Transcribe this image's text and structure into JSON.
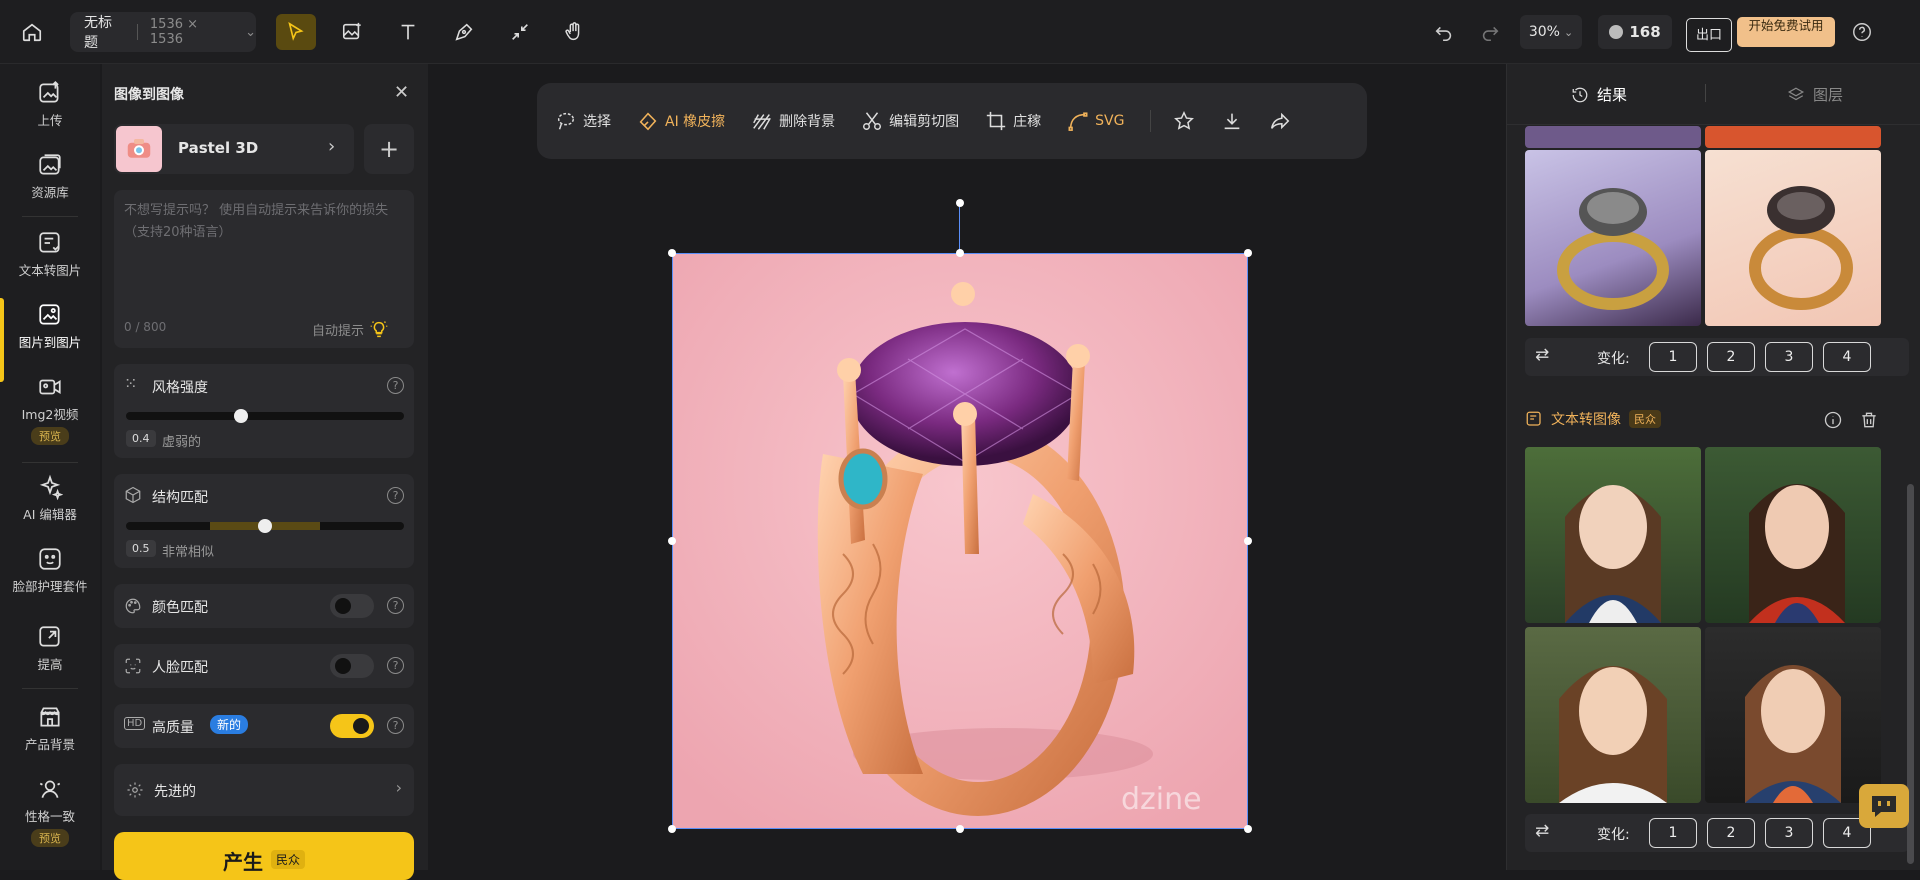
{
  "topbar": {
    "title": "无标题",
    "dimensions": "1536 × 1536",
    "zoom": "30%",
    "credits": "168",
    "exit_label": "出口",
    "trial_label": "开始免费试用"
  },
  "rail": {
    "items": [
      {
        "label": "上传",
        "icon": "upload-image-icon"
      },
      {
        "label": "资源库",
        "icon": "asset-library-icon"
      },
      {
        "label": "文本转图片",
        "icon": "text-to-image-icon"
      },
      {
        "label": "图片到图片",
        "icon": "image-to-image-icon"
      },
      {
        "label": "Img2视频",
        "icon": "img2video-icon",
        "badge": "预览"
      },
      {
        "label": "AI 编辑器",
        "icon": "ai-editor-icon"
      },
      {
        "label": "脸部护理套件",
        "icon": "face-kit-icon"
      },
      {
        "label": "提高",
        "icon": "enhance-icon"
      },
      {
        "label": "产品背景",
        "icon": "product-background-icon"
      },
      {
        "label": "性格一致",
        "icon": "character-consistency-icon",
        "badge": "预览"
      }
    ]
  },
  "panel": {
    "title": "图像到图像",
    "style_name": "Pastel 3D",
    "prompt_placeholder": "不想写提示吗？ 使用自动提示来告诉你的损失（支持20种语言）",
    "char_count": "0 / 800",
    "auto_prompt": "自动提示",
    "style_strength": {
      "label": "风格强度",
      "value": "0.4",
      "desc": "虚弱的",
      "fraction": 0.4
    },
    "structure_match": {
      "label": "结构匹配",
      "value": "0.5",
      "desc": "非常相似",
      "fraction": 0.5
    },
    "color_match": {
      "label": "颜色匹配",
      "on": false
    },
    "face_match": {
      "label": "人脸匹配",
      "on": false
    },
    "high_quality": {
      "label": "高质量",
      "badge": "新的",
      "on": true
    },
    "advanced": "先进的",
    "generate_label": "产生",
    "generate_badge": "民众"
  },
  "canvas_toolbar": {
    "items": [
      {
        "label": "选择",
        "icon": "lasso-select-icon",
        "accent": false
      },
      {
        "label": "AI 橡皮擦",
        "icon": "eraser-icon",
        "accent": true
      },
      {
        "label": "删除背景",
        "icon": "remove-background-icon",
        "accent": false
      },
      {
        "label": "编辑剪切图",
        "icon": "scissors-icon",
        "accent": false
      },
      {
        "label": "庄稼",
        "icon": "crop-icon",
        "accent": false
      },
      {
        "label": "SVG",
        "icon": "pen-curve-icon",
        "accent": true
      }
    ]
  },
  "canvas": {
    "watermark": "dzine"
  },
  "right": {
    "tabs": [
      "结果",
      "图层"
    ],
    "variation_label": "变化:",
    "variation_buttons": [
      "1",
      "2",
      "3",
      "4"
    ],
    "section_title": "文本转图像",
    "section_badge": "民众"
  },
  "colors": {
    "accent": "#f5c518",
    "orange": "#f0b25a",
    "pink_bg": "#f4b6bf"
  }
}
